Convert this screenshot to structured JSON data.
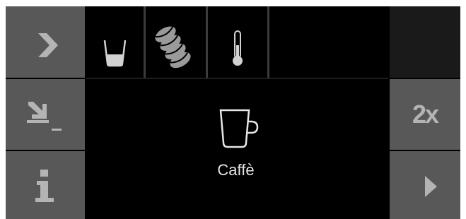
{
  "left_bar": {
    "next_icon": "chevron-right-icon",
    "standby_icon": "arrow-down-right-icon",
    "info_icon": "info-icon"
  },
  "settings_bar": {
    "icons": [
      "cup-fill-level-icon",
      "coffee-beans-strength-icon",
      "thermometer-temperature-icon"
    ]
  },
  "main": {
    "product_icon": "coffee-cup-icon",
    "product_name": "Caffè"
  },
  "right_bar": {
    "double_label": "2x",
    "start_icon": "play-icon"
  },
  "colors": {
    "background": "#000000",
    "button": "#585858",
    "button_icon": "#b4b4b4",
    "icon": "#d2d2d2"
  }
}
